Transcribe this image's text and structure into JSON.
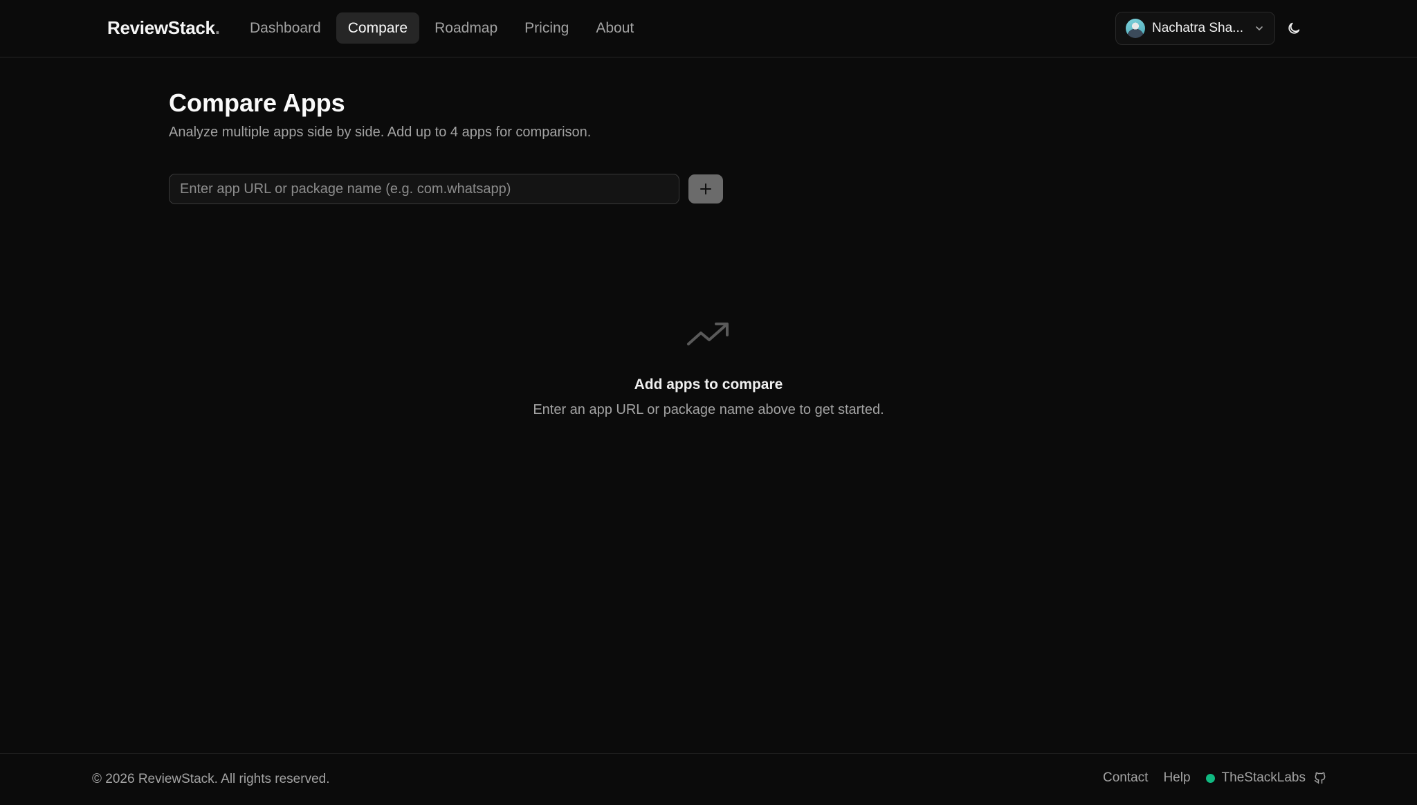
{
  "header": {
    "logo_text": "ReviewStack",
    "logo_dot": ".",
    "nav": [
      {
        "label": "Dashboard",
        "active": false
      },
      {
        "label": "Compare",
        "active": true
      },
      {
        "label": "Roadmap",
        "active": false
      },
      {
        "label": "Pricing",
        "active": false
      },
      {
        "label": "About",
        "active": false
      }
    ],
    "user": {
      "name": "Nachatra Sha..."
    },
    "icons": {
      "user_menu": "chevron-down-icon",
      "theme": "moon-icon"
    }
  },
  "main": {
    "title": "Compare Apps",
    "subtitle": "Analyze multiple apps side by side. Add up to 4 apps for comparison.",
    "input": {
      "value": "",
      "placeholder": "Enter app URL or package name (e.g. com.whatsapp)"
    },
    "add_button_icon": "plus-icon",
    "empty_state": {
      "icon": "trending-up-icon",
      "title": "Add apps to compare",
      "subtitle": "Enter an app URL or package name above to get started."
    }
  },
  "footer": {
    "copyright": "© 2026 ReviewStack. All rights reserved.",
    "links": [
      "Contact",
      "Help"
    ],
    "brand": "TheStackLabs",
    "status_color": "#10b981",
    "brand_icon": "github-icon"
  },
  "colors": {
    "background": "#0b0b0b",
    "nav_active_bg": "#262626",
    "add_button_bg": "#6b6b6b",
    "text_muted": "#a3a3a3"
  }
}
